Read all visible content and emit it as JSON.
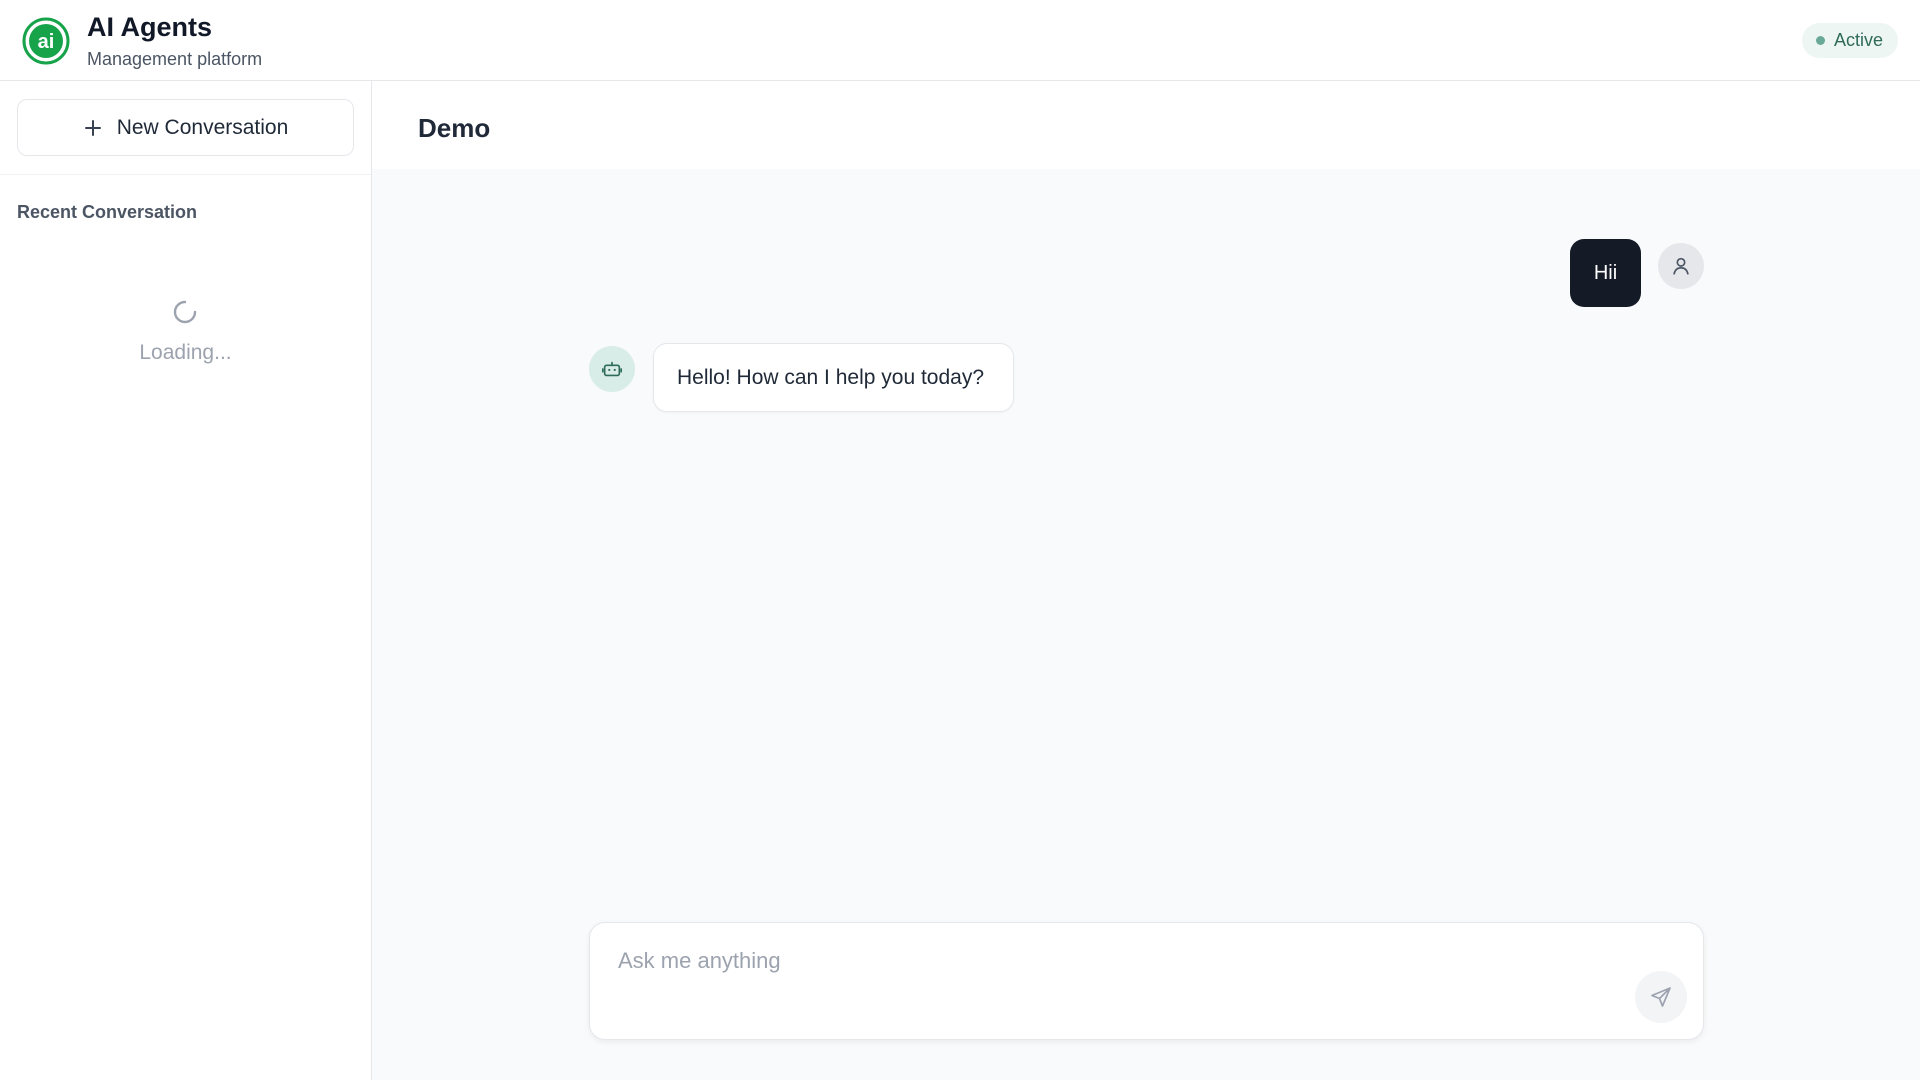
{
  "header": {
    "title": "AI Agents",
    "subtitle": "Management platform",
    "logo_text": "ai",
    "status": "Active"
  },
  "sidebar": {
    "new_conversation_label": "New Conversation",
    "recent_title": "Recent Conversation",
    "loading_text": "Loading..."
  },
  "main": {
    "conversation_title": "Demo",
    "messages": [
      {
        "role": "user",
        "text": "Hii"
      },
      {
        "role": "assistant",
        "text": "Hello! How can I help you today?"
      }
    ],
    "composer": {
      "placeholder": "Ask me anything",
      "value": ""
    }
  },
  "colors": {
    "brand_green": "#16a34a",
    "user_bubble": "#141a26",
    "status_bg": "#eef6f3",
    "status_text": "#2f6b59"
  },
  "icons": [
    "ai-logo-icon",
    "plus-icon",
    "spinner-icon",
    "user-icon",
    "bot-icon",
    "send-icon"
  ]
}
